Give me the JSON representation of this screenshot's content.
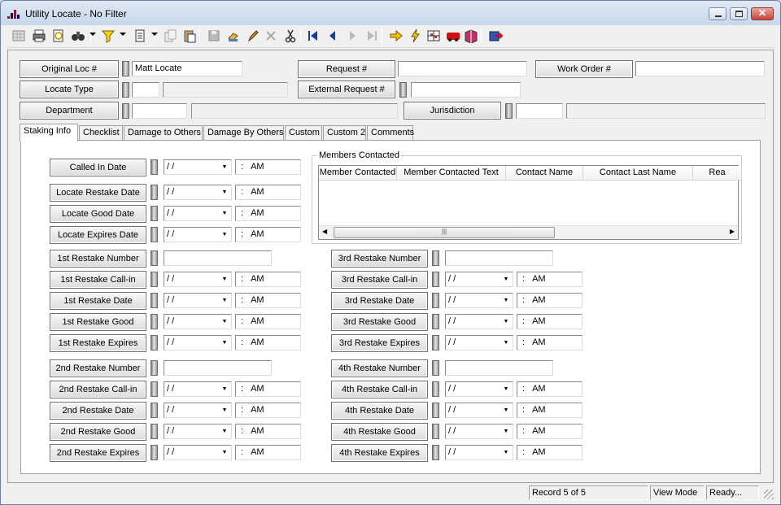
{
  "window": {
    "title": "Utility Locate - No Filter"
  },
  "toolbar": {
    "buttons": [
      "grid-icon",
      "print-icon",
      "print-preview-icon",
      "binoculars-icon",
      "filter-icon",
      "document-icon",
      "copy-icon",
      "paste-icon",
      "save-icon",
      "edit-icon",
      "pencil-icon",
      "delete-icon",
      "cut-icon",
      "first-record-icon",
      "prev-record-icon",
      "next-record-icon",
      "last-record-icon",
      "arrow-right-icon",
      "lightning-icon",
      "map-icon",
      "bus-icon",
      "book-icon",
      "exit-icon"
    ]
  },
  "header": {
    "original_loc_label": "Original Loc #",
    "original_loc_value": "Matt Locate",
    "request_label": "Request #",
    "request_value": "",
    "work_order_label": "Work Order #",
    "work_order_value": "",
    "locate_type_label": "Locate Type",
    "locate_type_code": "",
    "locate_type_desc": "",
    "external_request_label": "External Request #",
    "external_request_value": "",
    "department_label": "Department",
    "department_code": "",
    "department_desc": "",
    "jurisdiction_label": "Jurisdiction",
    "jurisdiction_code": "",
    "jurisdiction_desc": ""
  },
  "tabs": [
    "Staking Info",
    "Checklist",
    "Damage to Others",
    "Damage By Others",
    "Custom",
    "Custom 2",
    "Comments"
  ],
  "date_placeholder": " / /",
  "time_colon": ":",
  "time_ampm": "AM",
  "left_fields": [
    {
      "label": "Called In Date",
      "type": "datetime"
    },
    {
      "label": "Locate Restake Date",
      "type": "datetime"
    },
    {
      "label": "Locate Good Date",
      "type": "datetime"
    },
    {
      "label": "Locate Expires Date",
      "type": "datetime"
    },
    {
      "label": "1st Restake Number",
      "type": "text"
    },
    {
      "label": "1st Restake Call-in",
      "type": "datetime"
    },
    {
      "label": "1st Restake Date",
      "type": "datetime"
    },
    {
      "label": "1st Restake Good",
      "type": "datetime"
    },
    {
      "label": "1st Restake Expires",
      "type": "datetime"
    },
    {
      "label": "2nd Restake Number",
      "type": "text"
    },
    {
      "label": "2nd Restake Call-in",
      "type": "datetime"
    },
    {
      "label": "2nd Restake Date",
      "type": "datetime"
    },
    {
      "label": "2nd Restake Good",
      "type": "datetime"
    },
    {
      "label": "2nd Restake Expires",
      "type": "datetime"
    }
  ],
  "right_fields": [
    {
      "label": "3rd Restake Number",
      "type": "text"
    },
    {
      "label": "3rd Restake Call-in",
      "type": "datetime"
    },
    {
      "label": "3rd Restake Date",
      "type": "datetime"
    },
    {
      "label": "3rd Restake Good",
      "type": "datetime"
    },
    {
      "label": "3rd Restake Expires",
      "type": "datetime"
    },
    {
      "label": "4th Restake Number",
      "type": "text"
    },
    {
      "label": "4th Restake Call-in",
      "type": "datetime"
    },
    {
      "label": "4th Restake Date",
      "type": "datetime"
    },
    {
      "label": "4th Restake Good",
      "type": "datetime"
    },
    {
      "label": "4th Restake Expires",
      "type": "datetime"
    }
  ],
  "members": {
    "title": "Members Contacted",
    "columns": [
      "Member Contacted",
      "Member Contacted Text",
      "Contact Name",
      "Contact Last Name",
      "Rea"
    ]
  },
  "status": {
    "record": "Record 5 of 5",
    "mode": "View Mode",
    "state": "Ready..."
  }
}
